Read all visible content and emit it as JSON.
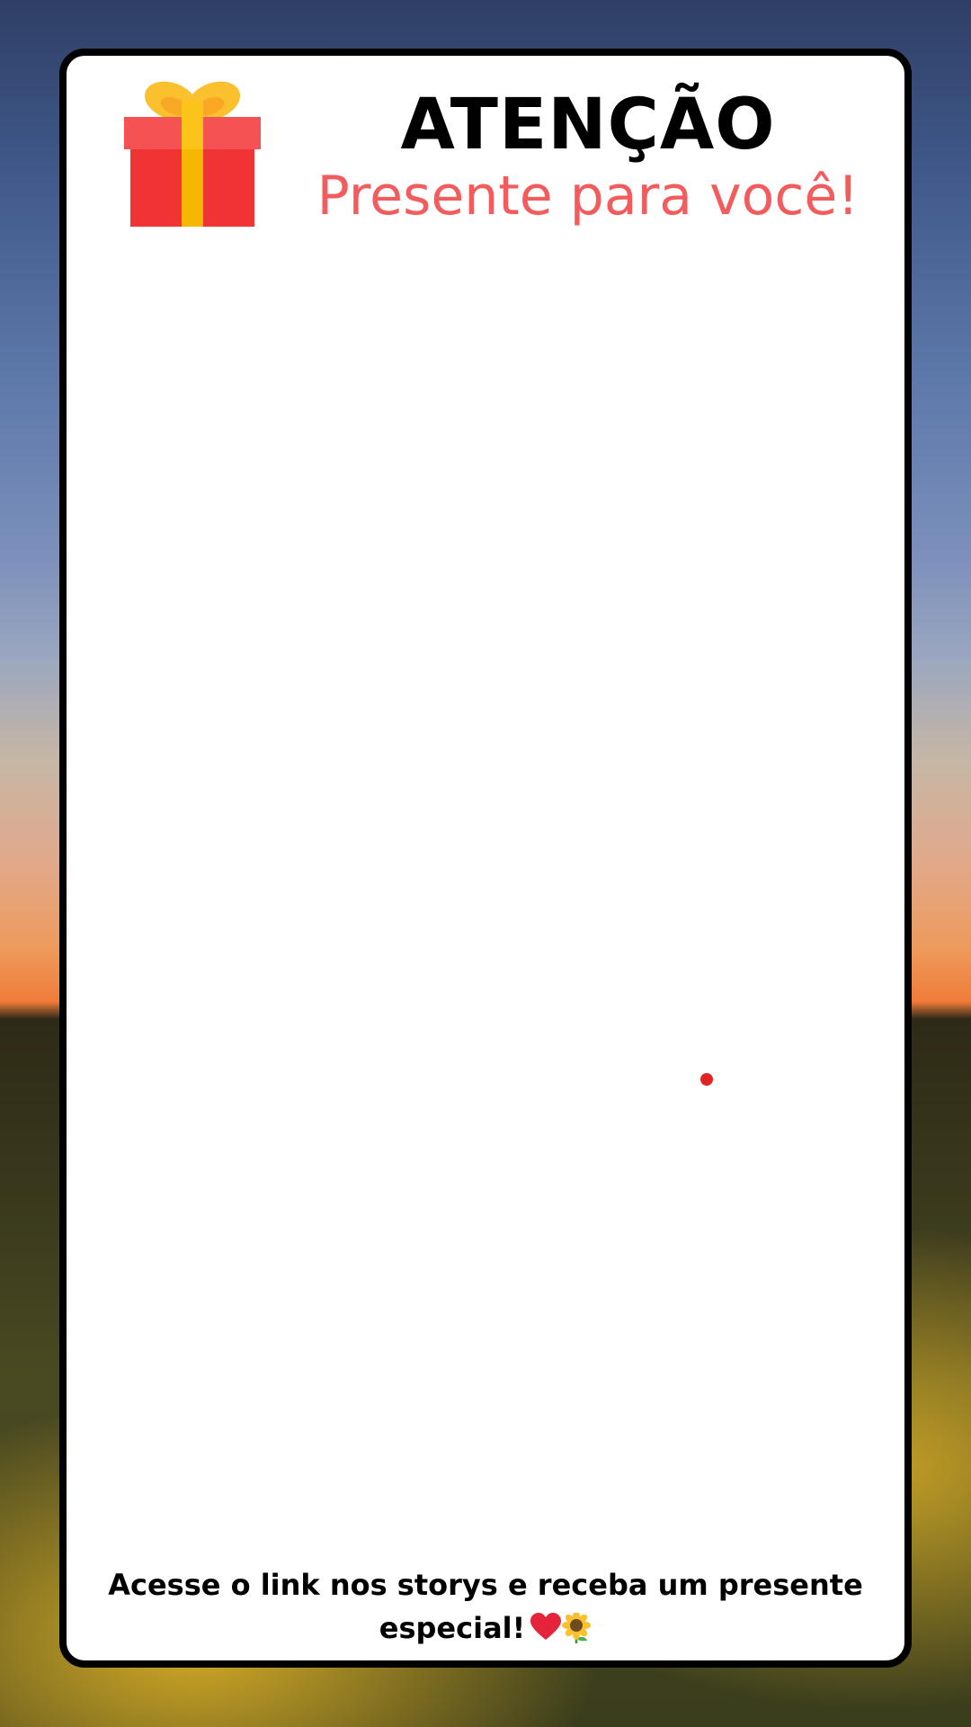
{
  "header": {
    "title": "ATENÇÃO",
    "subtitle": "Presente para você!"
  },
  "footer": {
    "message": "Acesse o link nos storys e receba um presente especial!"
  },
  "icons": {
    "gift": "gift-icon",
    "heart": "heart-icon",
    "sunflower": "sunflower-icon"
  },
  "colors": {
    "subtitle": "#f25c5c",
    "gift_box": "#f03434",
    "gift_ribbon": "#fcc419",
    "dot": "#e02424",
    "border": "#000000"
  }
}
